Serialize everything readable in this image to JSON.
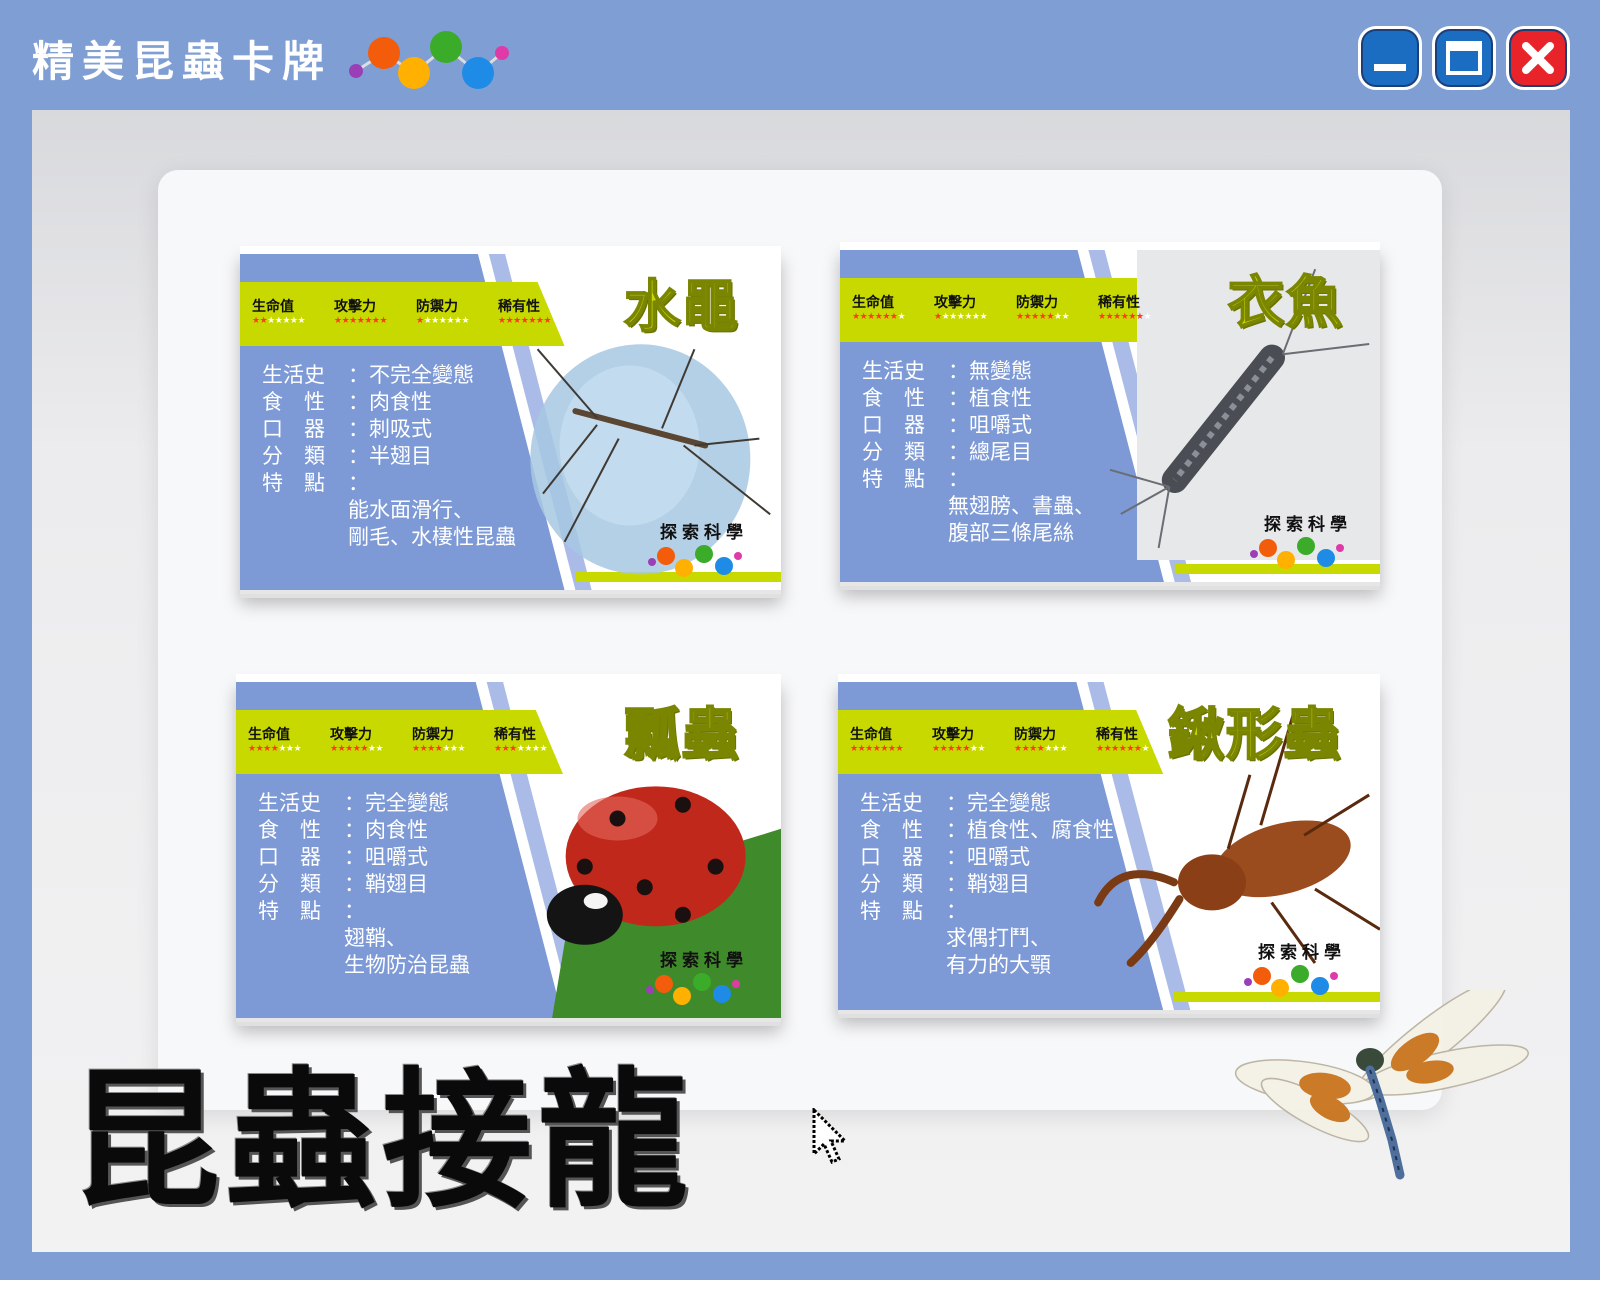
{
  "window": {
    "title": "精美昆蟲卡牌",
    "controls": {
      "minimize": "minimize-icon",
      "maximize": "maximize-icon",
      "close": "close-icon"
    }
  },
  "colors": {
    "frame": "#7f9ed4",
    "card_blue": "#7d9ad6",
    "accent_green": "#c8d900",
    "star_on": "#ff3a1e"
  },
  "stat_labels": [
    "生命值",
    "攻擊力",
    "防禦力",
    "稀有性"
  ],
  "brand": "探索科學",
  "cards": [
    {
      "name": "水黽",
      "stats": [
        2,
        7,
        1,
        7
      ],
      "fields": [
        {
          "key": "生活史",
          "value": "不完全變態"
        },
        {
          "key": "食　性",
          "value": "肉食性"
        },
        {
          "key": "口　器",
          "value": "刺吸式"
        },
        {
          "key": "分　類",
          "value": "半翅目"
        },
        {
          "key": "特　點",
          "value": ""
        }
      ],
      "notes": [
        "能水面滑行、",
        "剛毛、水棲性昆蟲"
      ],
      "image": "water-strider"
    },
    {
      "name": "衣魚",
      "stats": [
        6,
        1,
        5,
        6
      ],
      "fields": [
        {
          "key": "生活史",
          "value": "無變態"
        },
        {
          "key": "食　性",
          "value": "植食性"
        },
        {
          "key": "口　器",
          "value": "咀嚼式"
        },
        {
          "key": "分　類",
          "value": "總尾目"
        },
        {
          "key": "特　點",
          "value": ""
        }
      ],
      "notes": [
        "無翅膀、書蟲、",
        "腹部三條尾絲"
      ],
      "image": "silverfish"
    },
    {
      "name": "瓢蟲",
      "stats": [
        4,
        5,
        4,
        3
      ],
      "fields": [
        {
          "key": "生活史",
          "value": "完全變態"
        },
        {
          "key": "食　性",
          "value": "肉食性"
        },
        {
          "key": "口　器",
          "value": "咀嚼式"
        },
        {
          "key": "分　類",
          "value": "鞘翅目"
        },
        {
          "key": "特　點",
          "value": ""
        }
      ],
      "notes": [
        "翅鞘、",
        "生物防治昆蟲"
      ],
      "image": "ladybug"
    },
    {
      "name": "鍬形蟲",
      "stats": [
        7,
        5,
        4,
        6
      ],
      "fields": [
        {
          "key": "生活史",
          "value": "完全變態"
        },
        {
          "key": "食　性",
          "value": "植食性、腐食性"
        },
        {
          "key": "口　器",
          "value": "咀嚼式"
        },
        {
          "key": "分　類",
          "value": "鞘翅目"
        },
        {
          "key": "特　點",
          "value": ""
        }
      ],
      "notes": [
        "求偶打鬥、",
        "有力的大顎"
      ],
      "image": "stag-beetle"
    }
  ],
  "footer_title": "昆蟲接龍"
}
